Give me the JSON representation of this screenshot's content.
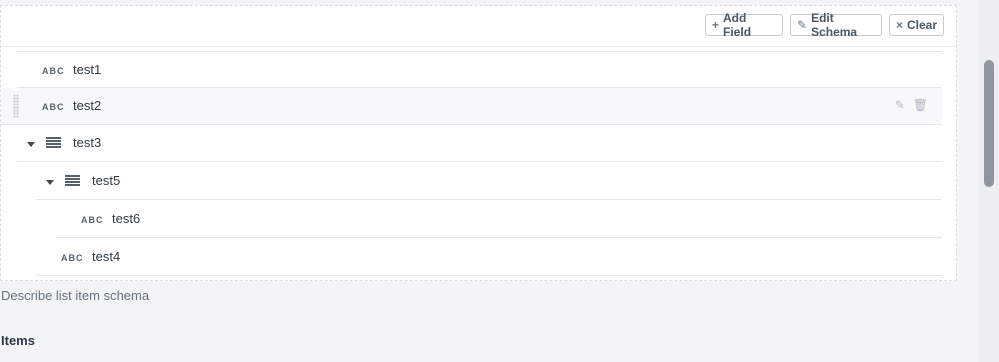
{
  "toolbar": {
    "add_field": "Add Field",
    "edit_schema": "Edit Schema",
    "clear": "Clear"
  },
  "icons": {
    "plus": "+",
    "pencil": "✎",
    "times": "×",
    "trash": "🗑"
  },
  "schema_fields": [
    {
      "type_badge": "ABC",
      "name": "test1"
    },
    {
      "type_badge": "ABC",
      "name": "test2"
    },
    {
      "type_badge": "",
      "name": "test3"
    },
    {
      "type_badge": "",
      "name": "test5"
    },
    {
      "type_badge": "ABC",
      "name": "test6"
    },
    {
      "type_badge": "ABC",
      "name": "test4"
    }
  ],
  "description": "Describe list item schema",
  "items_title": "Items"
}
